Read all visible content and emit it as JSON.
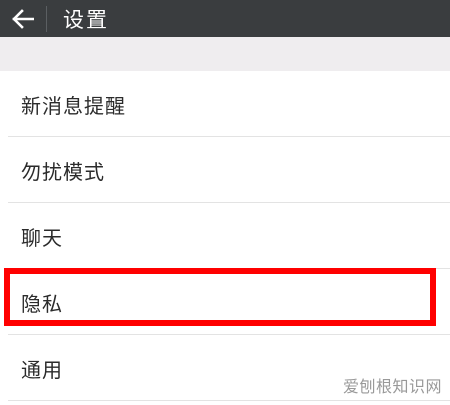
{
  "header": {
    "title": "设置",
    "back_icon": "arrow-left-icon"
  },
  "menu": {
    "items": [
      {
        "label": "新消息提醒"
      },
      {
        "label": "勿扰模式"
      },
      {
        "label": "聊天"
      },
      {
        "label": "隐私",
        "highlighted": true
      },
      {
        "label": "通用"
      }
    ]
  },
  "highlight_color": "#ff0000",
  "header_color": "#3a3d3f",
  "watermark": "爱刨根知识网"
}
